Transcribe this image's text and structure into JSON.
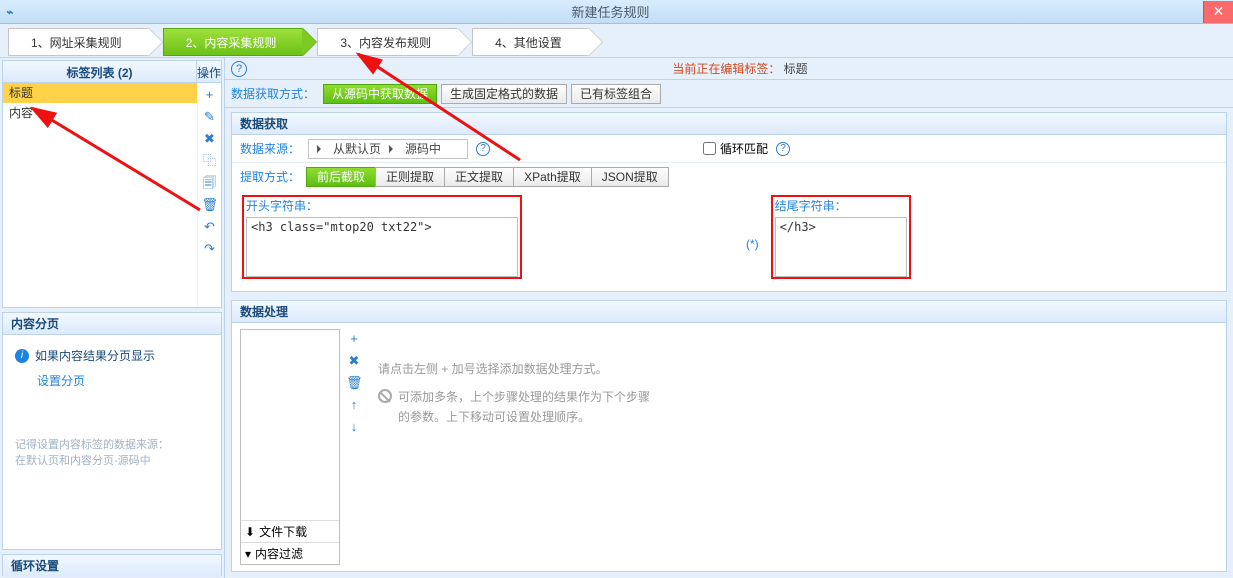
{
  "window": {
    "title": "新建任务规则"
  },
  "steps": [
    {
      "label": "1、网址采集规则"
    },
    {
      "label": "2、内容采集规则"
    },
    {
      "label": "3、内容发布规则"
    },
    {
      "label": "4、其他设置"
    }
  ],
  "tagList": {
    "header": "标签列表 (2)",
    "ops_header": "操作",
    "rows": [
      {
        "label": "标题",
        "selected": true
      },
      {
        "label": "内容",
        "selected": false
      }
    ],
    "ops": [
      "+",
      "✎",
      "✖",
      "⿻",
      "🗐",
      "🗑",
      "↶",
      "↷"
    ]
  },
  "pagination": {
    "header": "内容分页",
    "info": "如果内容结果分页显示",
    "link": "设置分页",
    "hint": "记得设置内容标签的数据来源：\n在默认页和内容分页-源码中"
  },
  "loop": {
    "header": "循环设置"
  },
  "editingBar": {
    "label": "当前正在编辑标签：",
    "value": "标题"
  },
  "methodRow": {
    "label": "数据获取方式：",
    "buttons": [
      {
        "label": "从源码中获取数据",
        "active": true
      },
      {
        "label": "生成固定格式的数据",
        "active": false
      },
      {
        "label": "已有标签组合",
        "active": false
      }
    ]
  },
  "dataAcquire": {
    "header": "数据获取",
    "sourceLabel": "数据来源：",
    "sourceParts": [
      "从默认页",
      "源码中"
    ],
    "loopMatch": "循环匹配",
    "extractLabel": "提取方式：",
    "extractTabs": [
      {
        "label": "前后截取",
        "active": true
      },
      {
        "label": "正则提取",
        "active": false
      },
      {
        "label": "正文提取",
        "active": false
      },
      {
        "label": "XPath提取",
        "active": false
      },
      {
        "label": "JSON提取",
        "active": false
      }
    ],
    "startLabel": "开头字符串：",
    "startValue": "<h3 class=\"mtop20 txt22\">",
    "wildcard": "(*)",
    "endLabel": "结尾字符串：",
    "endValue": "</h3>"
  },
  "dataProcess": {
    "header": "数据处理",
    "ops": [
      "+",
      "✖",
      "🗑",
      "↑",
      "↓"
    ],
    "footer1": "文件下载",
    "footer2": "内容过滤",
    "hint1": "请点击左侧 + 加号选择添加数据处理方式。",
    "hint2": "可添加多条，上个步骤处理的结果作为下个步骤的参数。上下移动可设置处理顺序。"
  }
}
